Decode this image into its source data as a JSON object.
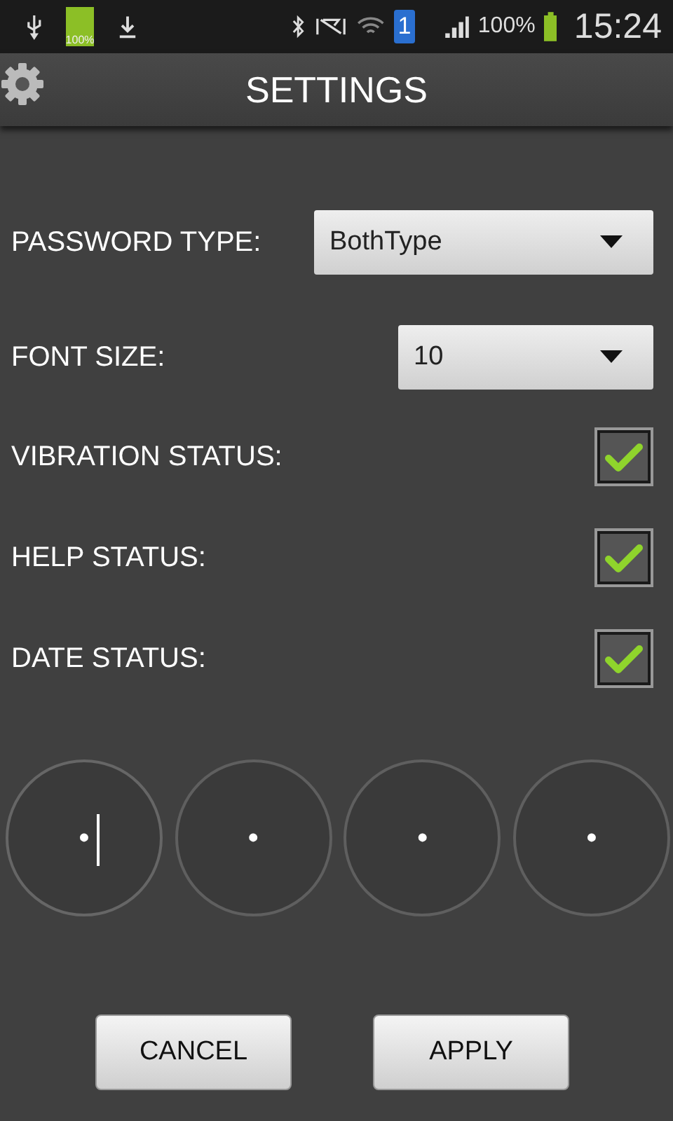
{
  "status_bar": {
    "battery_notice": "100%",
    "sim_badge": "1",
    "battery_percent": "100%",
    "time": "15:24"
  },
  "title": "SETTINGS",
  "dropdowns": [
    {
      "label": "PASSWORD TYPE:",
      "value": "BothType"
    },
    {
      "label": "FONT SIZE:",
      "value": "10"
    }
  ],
  "checkboxes": [
    {
      "label": "VIBRATION STATUS:",
      "checked": true
    },
    {
      "label": "HELP STATUS:",
      "checked": true
    },
    {
      "label": "DATE STATUS:",
      "checked": true
    }
  ],
  "pin_fields": [
    {
      "value": "•",
      "focused": true
    },
    {
      "value": "•",
      "focused": false
    },
    {
      "value": "•",
      "focused": false
    },
    {
      "value": "•",
      "focused": false
    }
  ],
  "buttons": [
    "CANCEL",
    "APPLY"
  ]
}
